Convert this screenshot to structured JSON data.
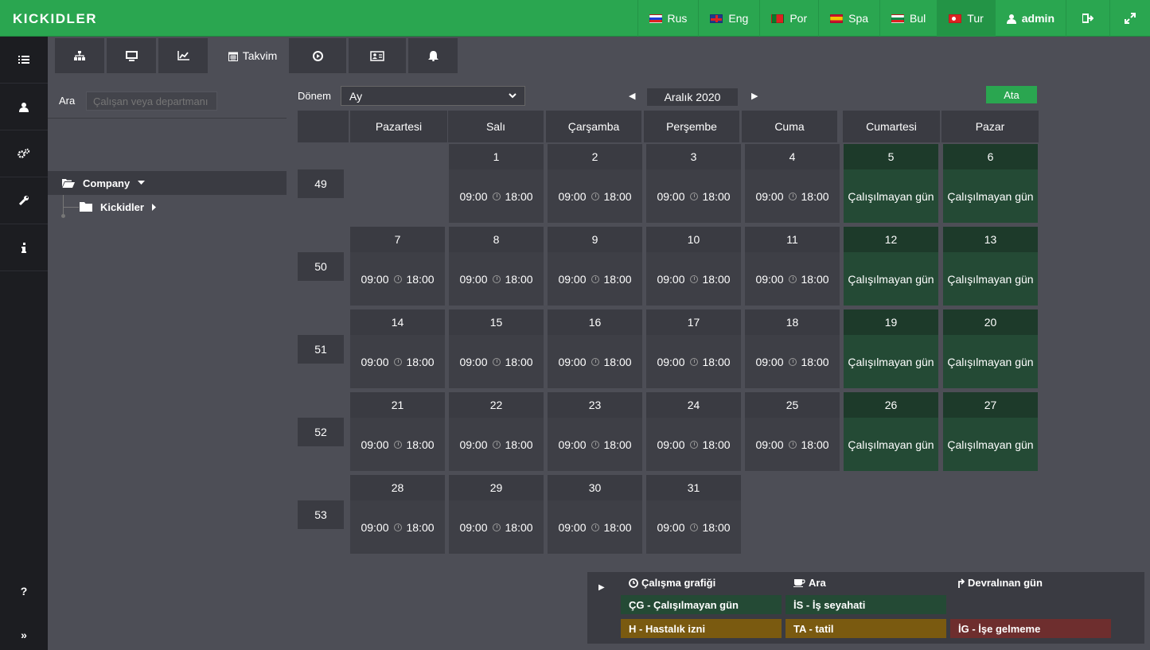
{
  "topbar": {
    "logo": "KICKIDLER",
    "languages": [
      {
        "code": "rus",
        "label": "Rus"
      },
      {
        "code": "eng",
        "label": "Eng"
      },
      {
        "code": "por",
        "label": "Por"
      },
      {
        "code": "spa",
        "label": "Spa"
      },
      {
        "code": "bul",
        "label": "Bul"
      },
      {
        "code": "tur",
        "label": "Tur"
      }
    ],
    "user": "admin",
    "accent": "#2aa650"
  },
  "leftnav": {
    "items": [
      "list-icon",
      "user-icon",
      "gears-icon",
      "wrench-icon",
      "info-icon"
    ],
    "help": "?",
    "expand": "»"
  },
  "tabs": {
    "calendar_label": "Takvim"
  },
  "sidebar": {
    "search_label": "Ara",
    "search_placeholder": "Çalışan veya departmanı",
    "tree_root": "Company",
    "tree_child": "Kickidler"
  },
  "calendar": {
    "period_label": "Dönem",
    "period_value": "Ay",
    "month": "Aralık 2020",
    "assign_button": "Ata",
    "days": [
      "Pazartesi",
      "Salı",
      "Çarşamba",
      "Perşembe",
      "Cuma",
      "Cumartesi",
      "Pazar"
    ],
    "weeks": [
      "49",
      "50",
      "51",
      "52",
      "53"
    ],
    "work_start": "09:00",
    "work_end": "18:00",
    "off_label": "Çalışılmayan gün",
    "month_days": [
      {
        "d": "1",
        "off": false
      },
      {
        "d": "2",
        "off": false
      },
      {
        "d": "3",
        "off": false
      },
      {
        "d": "4",
        "off": false
      },
      {
        "d": "5",
        "off": true
      },
      {
        "d": "6",
        "off": true
      },
      {
        "d": "7",
        "off": false
      },
      {
        "d": "8",
        "off": false
      },
      {
        "d": "9",
        "off": false
      },
      {
        "d": "10",
        "off": false
      },
      {
        "d": "11",
        "off": false
      },
      {
        "d": "12",
        "off": true
      },
      {
        "d": "13",
        "off": true
      },
      {
        "d": "14",
        "off": false
      },
      {
        "d": "15",
        "off": false
      },
      {
        "d": "16",
        "off": false
      },
      {
        "d": "17",
        "off": false
      },
      {
        "d": "18",
        "off": false
      },
      {
        "d": "19",
        "off": true
      },
      {
        "d": "20",
        "off": true
      },
      {
        "d": "21",
        "off": false
      },
      {
        "d": "22",
        "off": false
      },
      {
        "d": "23",
        "off": false
      },
      {
        "d": "24",
        "off": false
      },
      {
        "d": "25",
        "off": false
      },
      {
        "d": "26",
        "off": true
      },
      {
        "d": "27",
        "off": true
      },
      {
        "d": "28",
        "off": false
      },
      {
        "d": "29",
        "off": false
      },
      {
        "d": "30",
        "off": false
      },
      {
        "d": "31",
        "off": false
      }
    ]
  },
  "legend": {
    "schedule": "Çalışma grafiği",
    "break": "Ara",
    "carried": "Devralınan gün",
    "items": [
      {
        "label": "ÇG - Çalışılmayan gün",
        "color": "#244a35"
      },
      {
        "label": "İS - İş seyahati",
        "color": "#244a35"
      },
      {
        "label": "H - Hastalık izni",
        "color": "#7a5a10"
      },
      {
        "label": "TA - tatil",
        "color": "#7a5a10"
      },
      {
        "label": "İG - İşe gelmeme",
        "color": "#6e2e2e"
      }
    ]
  }
}
